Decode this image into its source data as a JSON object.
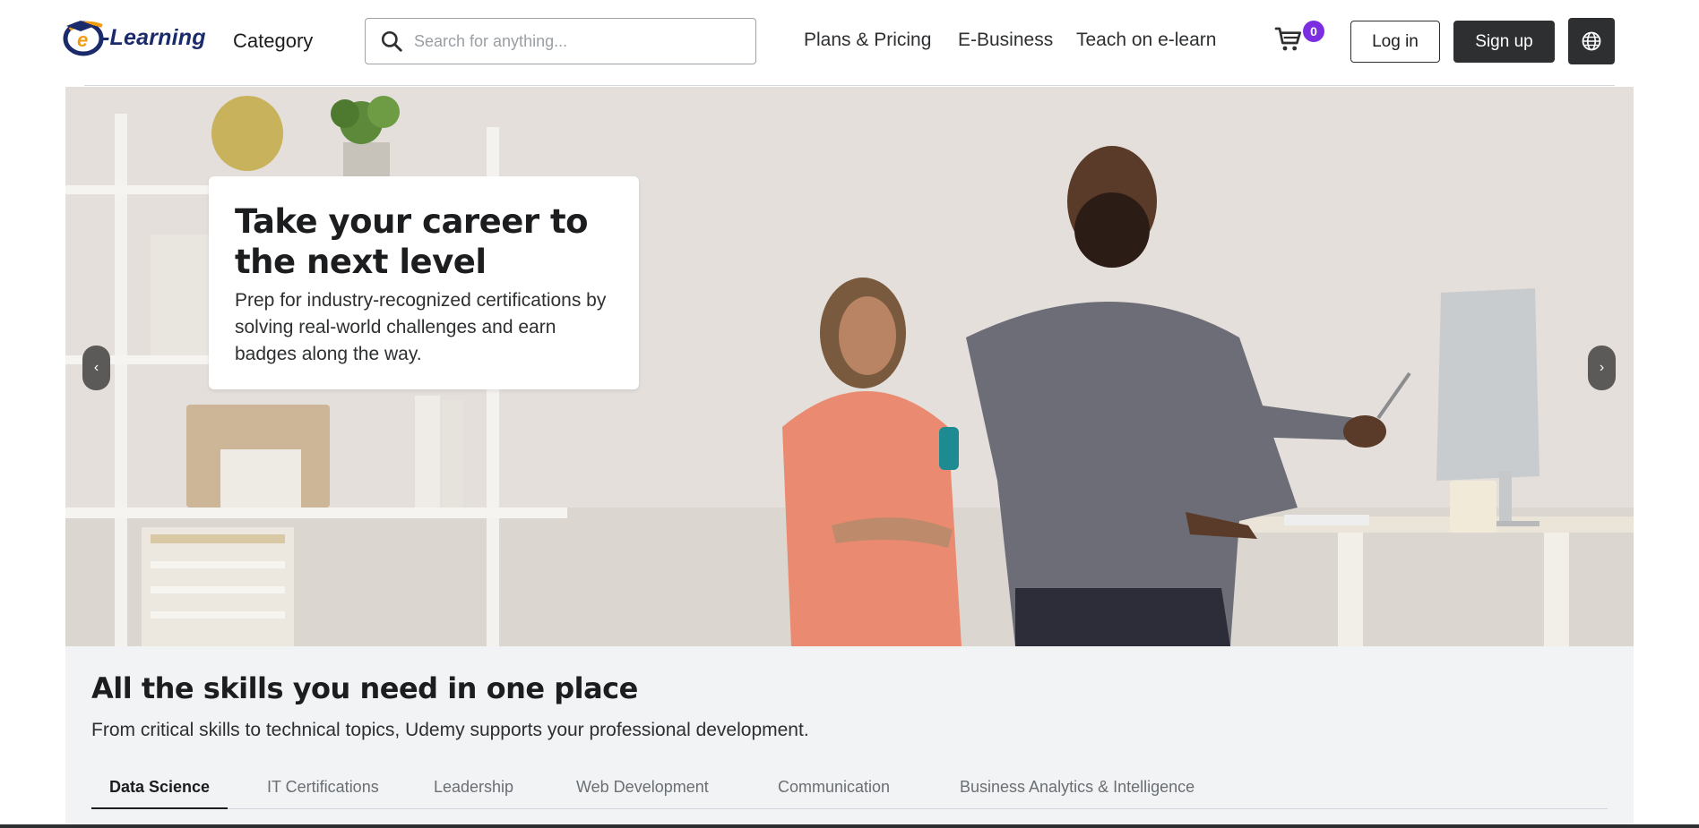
{
  "header": {
    "logo_text": "-Learning",
    "logo_letter": "e",
    "category": "Category",
    "search_placeholder": "Search for anything...",
    "nav": [
      "Plans & Pricing",
      "E-Business",
      "Teach on e-learn"
    ],
    "cart_count": "0",
    "login_label": "Log in",
    "signup_label": "Sign up"
  },
  "hero": {
    "title": "Take your career to the next level",
    "text": "Prep for industry-recognized certifications by solving real-world challenges and earn badges along the way.",
    "prev_icon": "‹",
    "next_icon": "›"
  },
  "skills": {
    "title": "All the skills you need in one place",
    "subtitle": "From critical skills to technical topics, Udemy supports your professional development.",
    "tabs": [
      "Data Science",
      "IT Certifications",
      "Leadership",
      "Web Development",
      "Communication",
      "Business Analytics & Intelligence"
    ],
    "active_tab": "Data Science"
  },
  "colors": {
    "accent": "#7b2ee0",
    "dark": "#2d2f31",
    "logo_blue": "#1b2a6b",
    "logo_orange": "#f39c12"
  },
  "icons": {
    "search": "search-icon",
    "cart": "cart-icon",
    "globe": "globe-icon",
    "prev": "chevron-left-icon",
    "next": "chevron-right-icon"
  }
}
